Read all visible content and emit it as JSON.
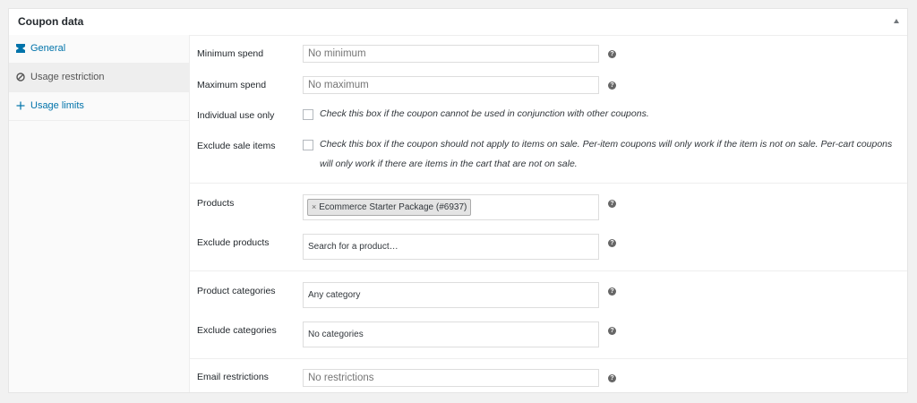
{
  "panel": {
    "title": "Coupon data",
    "collapse_icon": "triangle-up-icon"
  },
  "tabs": [
    {
      "label": "General",
      "icon": "ticket-icon",
      "active": false
    },
    {
      "label": "Usage restriction",
      "icon": "prohibited-icon",
      "active": true
    },
    {
      "label": "Usage limits",
      "icon": "plus-icon",
      "active": false
    }
  ],
  "spend": {
    "minimum_label": "Minimum spend",
    "minimum_placeholder": "No minimum",
    "maximum_label": "Maximum spend",
    "maximum_placeholder": "No maximum",
    "individual_label": "Individual use only",
    "individual_desc": "Check this box if the coupon cannot be used in conjunction with other coupons.",
    "exclude_sale_label": "Exclude sale items",
    "exclude_sale_desc": "Check this box if the coupon should not apply to items on sale. Per-item coupons will only work if the item is not on sale. Per-cart coupons will only work if there are items in the cart that are not on sale."
  },
  "products": {
    "products_label": "Products",
    "selected_product": "Ecommerce Starter Package (#6937)",
    "chip_remove": "×",
    "exclude_label": "Exclude products",
    "exclude_placeholder": "Search for a product…"
  },
  "categories": {
    "categories_label": "Product categories",
    "categories_placeholder": "Any category",
    "exclude_label": "Exclude categories",
    "exclude_placeholder": "No categories"
  },
  "email": {
    "label": "Email restrictions",
    "placeholder": "No restrictions"
  },
  "help_glyph": "?"
}
